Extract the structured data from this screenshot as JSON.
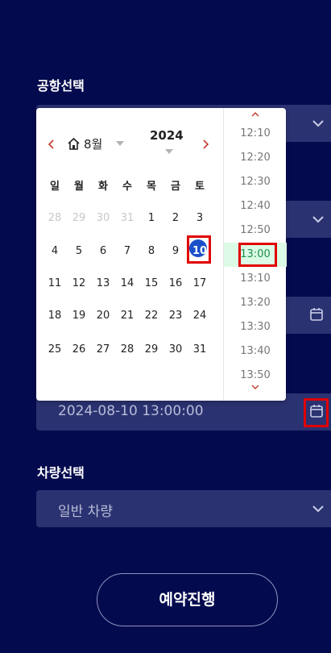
{
  "labels": {
    "airport": "공항선택",
    "vehicle": "차량선택"
  },
  "fields": {
    "datetime_value": "2024-08-10 13:00:00",
    "vehicle_value": "일반 차량"
  },
  "calendar": {
    "month": "8월",
    "year": "2024",
    "weekdays": [
      "일",
      "월",
      "화",
      "수",
      "목",
      "금",
      "토"
    ],
    "weeks": [
      [
        "28",
        "29",
        "30",
        "31",
        "1",
        "2",
        "3"
      ],
      [
        "4",
        "5",
        "6",
        "7",
        "8",
        "9",
        "10"
      ],
      [
        "11",
        "12",
        "13",
        "14",
        "15",
        "16",
        "17"
      ],
      [
        "18",
        "19",
        "20",
        "21",
        "22",
        "23",
        "24"
      ],
      [
        "25",
        "26",
        "27",
        "28",
        "29",
        "30",
        "31"
      ]
    ],
    "selected_day": "10",
    "times": [
      "12:10",
      "12:20",
      "12:30",
      "12:40",
      "12:50",
      "13:00",
      "13:10",
      "13:20",
      "13:30",
      "13:40",
      "13:50"
    ],
    "selected_time": "13:00"
  },
  "actions": {
    "submit": "예약진행"
  },
  "colors": {
    "background": "#040a4e",
    "field": "#2b3271",
    "selected_day": "#1b4fc9",
    "selected_time_bg": "#dcfbe6",
    "selected_time_text": "#1a8f4a",
    "highlight": "#e00000"
  }
}
